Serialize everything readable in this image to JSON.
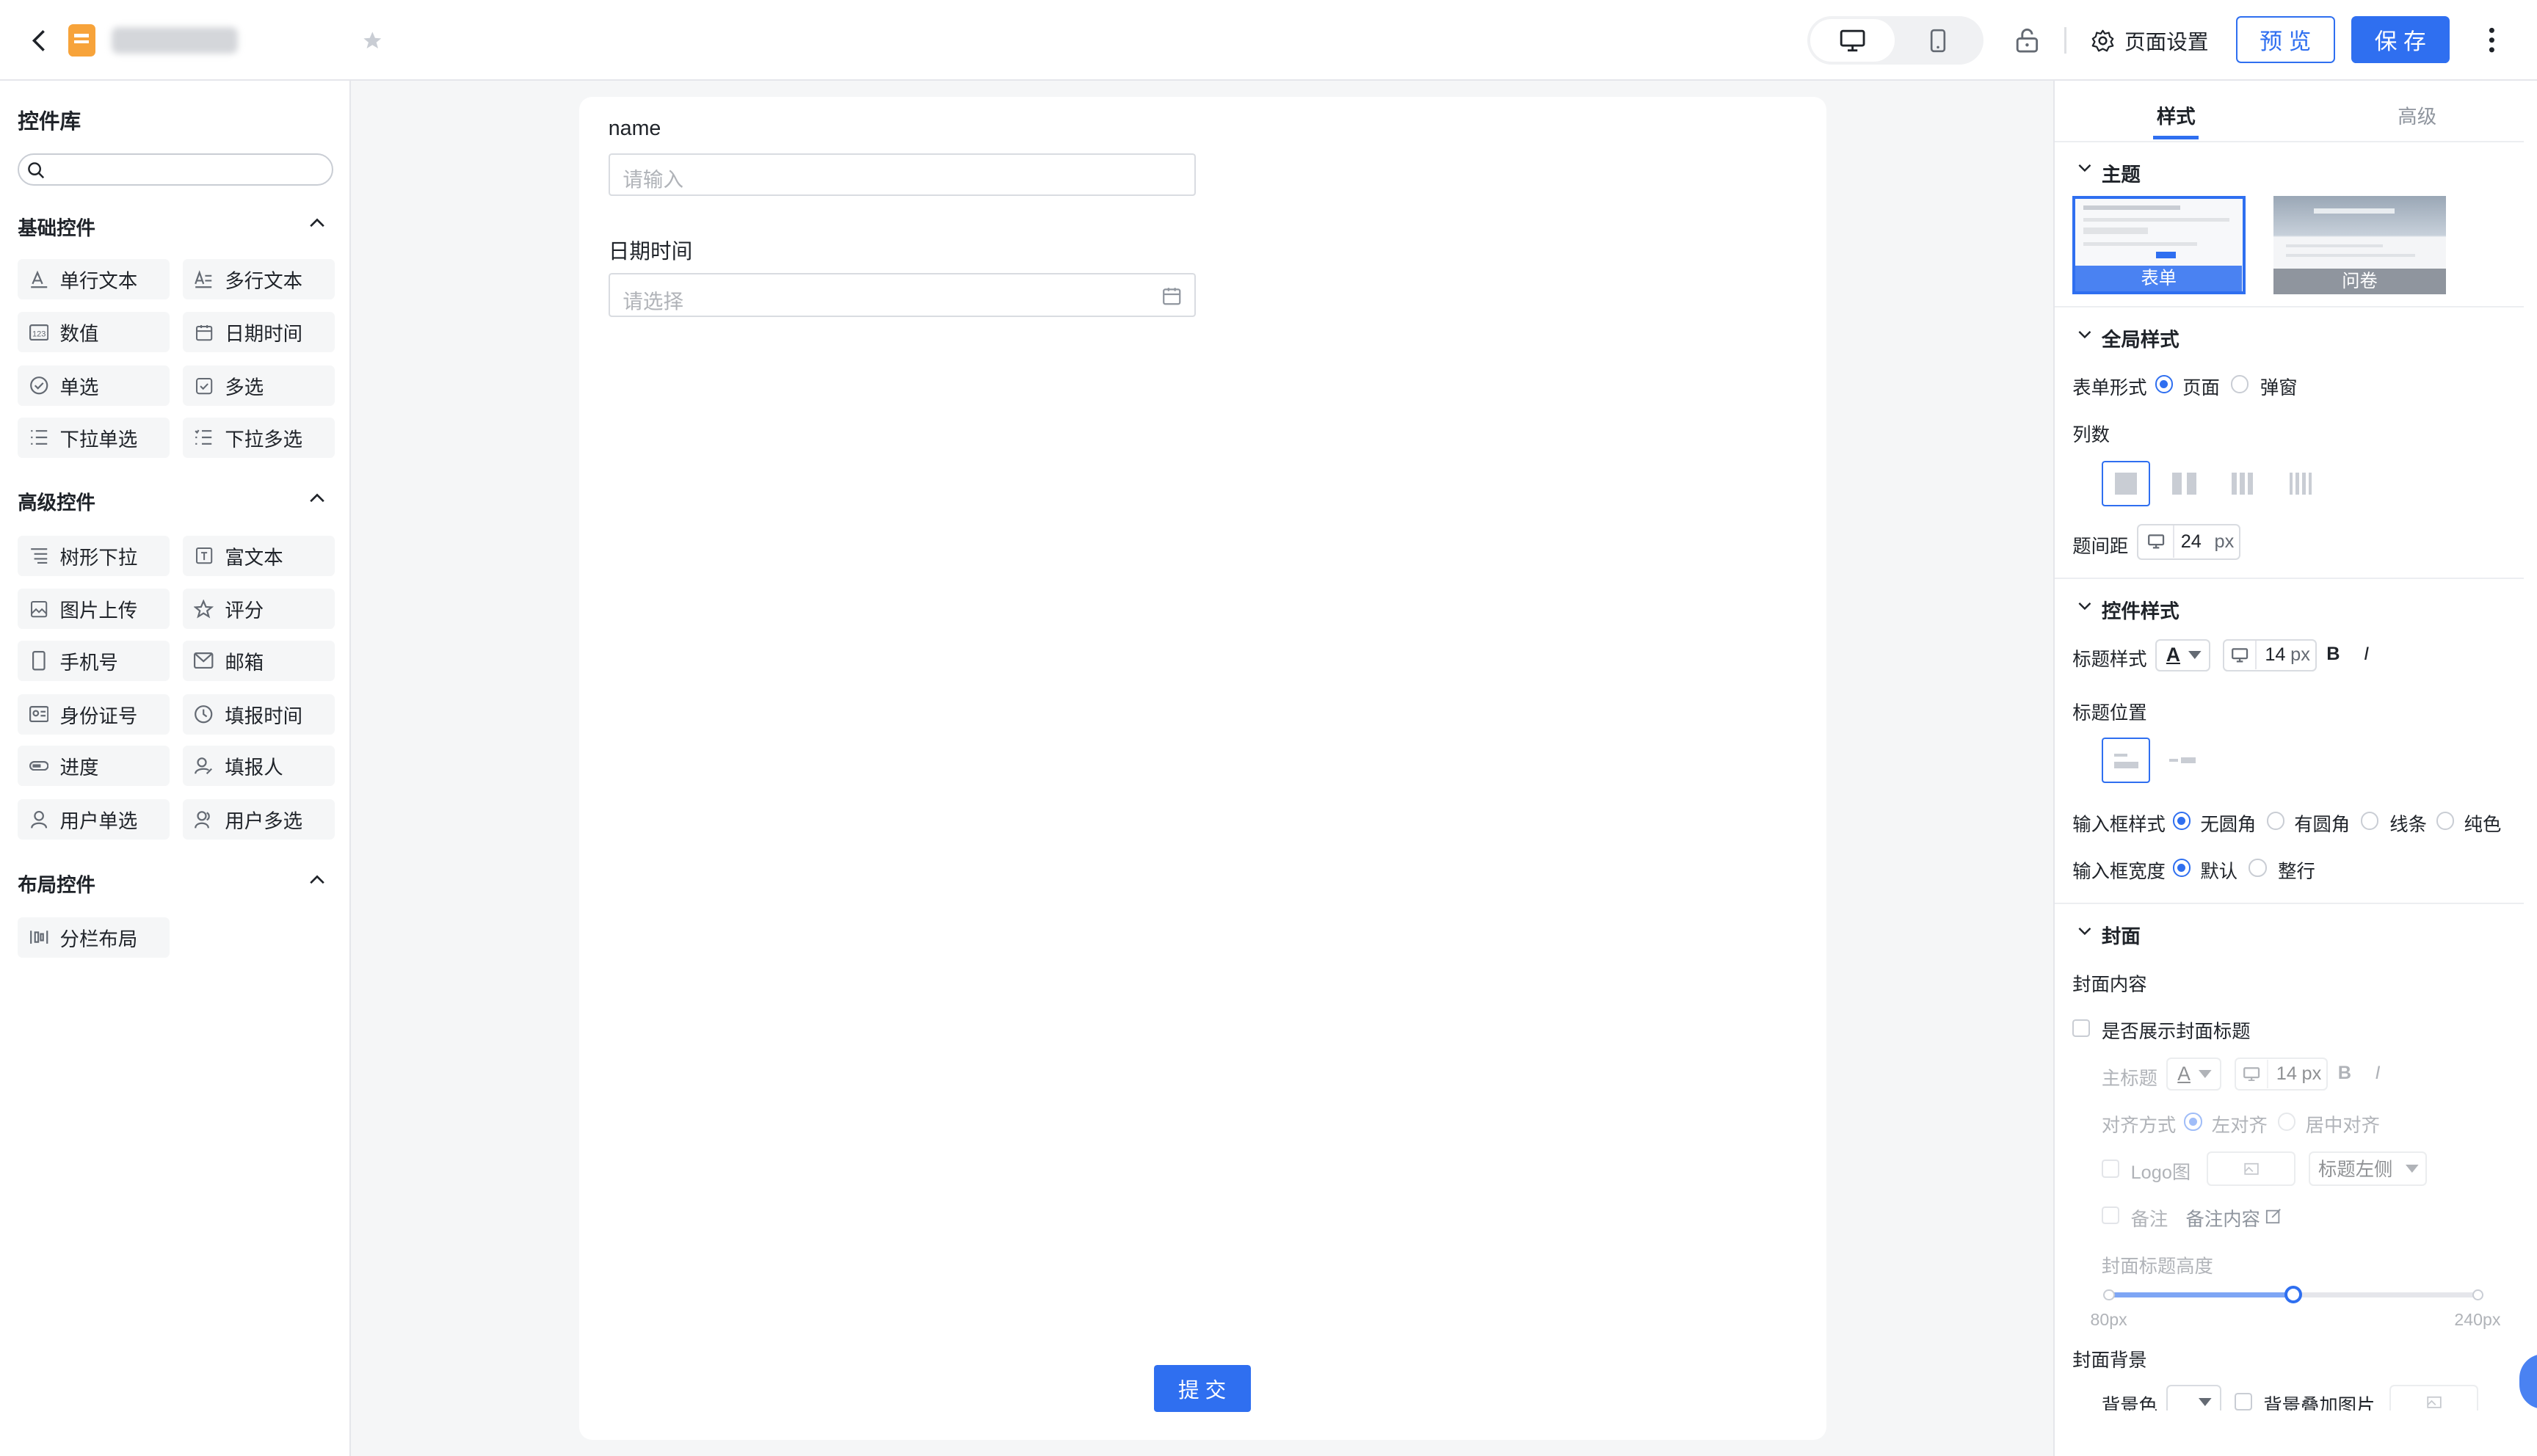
{
  "header": {
    "app_title": "",
    "preview_label": "预 览",
    "save_label": "保 存",
    "page_settings_label": "页面设置"
  },
  "library": {
    "title": "控件库",
    "search_placeholder": "",
    "basic": {
      "title": "基础控件",
      "items": [
        {
          "label": "单行文本",
          "icon": "single-line-text-icon"
        },
        {
          "label": "多行文本",
          "icon": "multi-line-text-icon"
        },
        {
          "label": "数值",
          "icon": "number-icon"
        },
        {
          "label": "日期时间",
          "icon": "calendar-icon"
        },
        {
          "label": "单选",
          "icon": "radio-icon"
        },
        {
          "label": "多选",
          "icon": "checkbox-icon"
        },
        {
          "label": "下拉单选",
          "icon": "dropdown-list-icon"
        },
        {
          "label": "下拉多选",
          "icon": "dropdown-multi-icon"
        }
      ]
    },
    "advanced": {
      "title": "高级控件",
      "items": [
        {
          "label": "树形下拉",
          "icon": "tree-select-icon"
        },
        {
          "label": "富文本",
          "icon": "rich-text-icon"
        },
        {
          "label": "图片上传",
          "icon": "image-upload-icon"
        },
        {
          "label": "评分",
          "icon": "star-icon"
        },
        {
          "label": "手机号",
          "icon": "phone-icon"
        },
        {
          "label": "邮箱",
          "icon": "mail-icon"
        },
        {
          "label": "身份证号",
          "icon": "id-card-icon"
        },
        {
          "label": "填报时间",
          "icon": "clock-icon"
        },
        {
          "label": "进度",
          "icon": "progress-icon"
        },
        {
          "label": "填报人",
          "icon": "user-edit-icon"
        },
        {
          "label": "用户单选",
          "icon": "user-icon"
        },
        {
          "label": "用户多选",
          "icon": "users-icon"
        }
      ]
    },
    "layout": {
      "title": "布局控件",
      "items": [
        {
          "label": "分栏布局",
          "icon": "columns-icon"
        }
      ]
    }
  },
  "form": {
    "fields": [
      {
        "label": "name",
        "placeholder": "请输入"
      },
      {
        "label": "日期时间",
        "placeholder": "请选择"
      }
    ],
    "submit_label": "提 交"
  },
  "panel": {
    "tabs": [
      "样式",
      "高级"
    ],
    "active_tab": "样式",
    "theme": {
      "title": "主题",
      "options": [
        "表单",
        "问卷"
      ],
      "selected": "表单"
    },
    "global": {
      "title": "全局样式",
      "form_type_label": "表单形式",
      "form_type_options": [
        "页面",
        "弹窗"
      ],
      "form_type_selected": "页面",
      "columns_label": "列数",
      "columns_selected": 1,
      "spacing_label": "题间距",
      "spacing_value": "24",
      "spacing_unit": "px"
    },
    "control": {
      "title": "控件样式",
      "title_style_label": "标题样式",
      "font_icon_text": "A",
      "font_size": "14",
      "font_unit": "px",
      "bold_label": "B",
      "italic_label": "I",
      "title_position_label": "标题位置",
      "input_style_label": "输入框样式",
      "input_style_options": [
        "无圆角",
        "有圆角",
        "线条",
        "纯色"
      ],
      "input_style_selected": "无圆角",
      "input_width_label": "输入框宽度",
      "input_width_options": [
        "默认",
        "整行"
      ],
      "input_width_selected": "默认"
    },
    "cover": {
      "title": "封面",
      "content_label": "封面内容",
      "show_title_label": "是否展示封面标题",
      "main_title_label": "主标题",
      "main_font_size": "14",
      "main_font_unit": "px",
      "align_label": "对齐方式",
      "align_options": [
        "左对齐",
        "居中对齐"
      ],
      "align_selected": "左对齐",
      "logo_label": "Logo图",
      "logo_position": "标题左侧",
      "note_label": "备注",
      "note_content": "备注内容",
      "height_label": "封面标题高度",
      "height_min": "80px",
      "height_max": "240px",
      "height_fraction": 0.5,
      "bg_label": "封面背景",
      "bg_color_label": "背景色",
      "bg_image_label": "背景叠加图片"
    }
  },
  "colors": {
    "primary": "#2f6ff0",
    "canvas_bg": "#f5f6f7",
    "text": "#1f2329",
    "muted": "#8f959e"
  }
}
